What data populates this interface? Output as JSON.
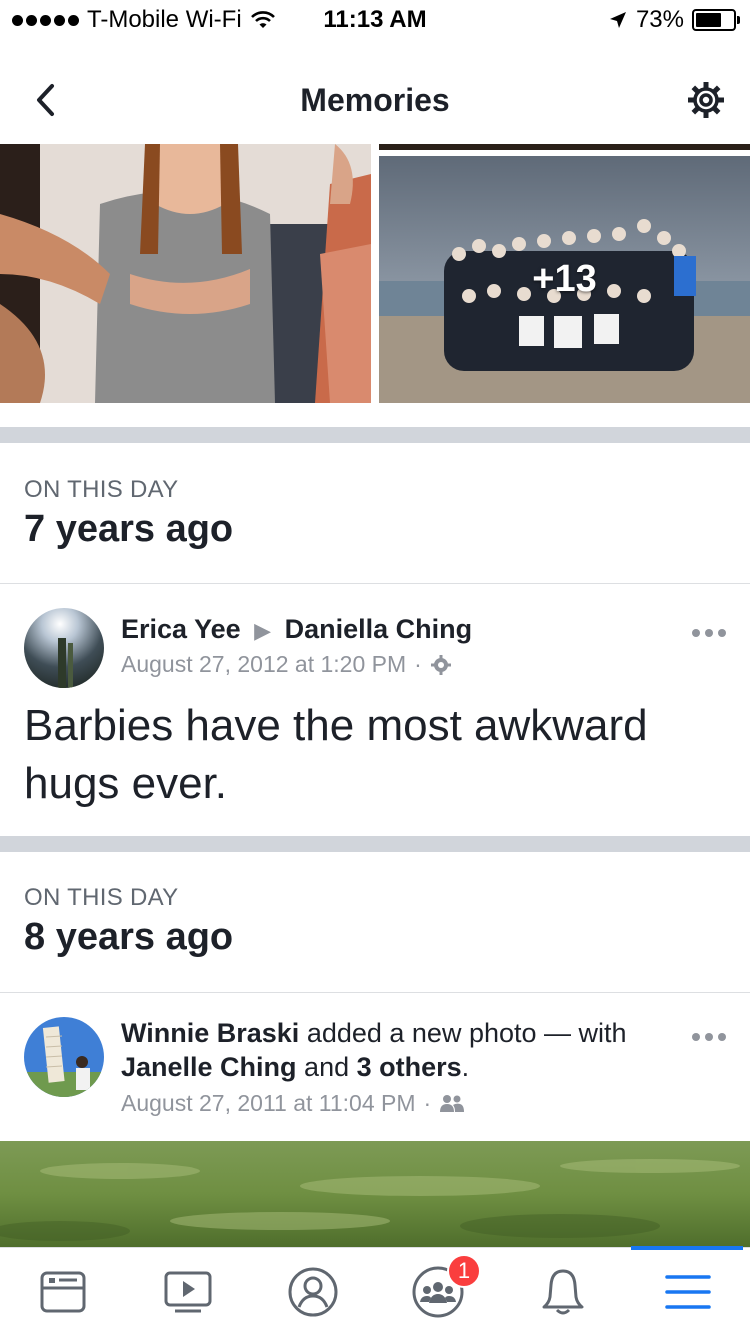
{
  "status_bar": {
    "carrier": "T-Mobile Wi-Fi",
    "time": "11:13 AM",
    "battery": "73%"
  },
  "nav": {
    "title": "Memories"
  },
  "photos": {
    "more_count": "+13"
  },
  "memories": [
    {
      "day_label": "ON THIS DAY",
      "years_ago": "7 years ago",
      "post": {
        "author": "Erica Yee",
        "target": "Daniella Ching",
        "timestamp": "August 27, 2012 at 1:20 PM",
        "text": "Barbies have the most awkward hugs ever."
      }
    },
    {
      "day_label": "ON THIS DAY",
      "years_ago": "8 years ago",
      "post": {
        "author": "Winnie Braski",
        "action": " added a new photo — with",
        "tagged": "Janelle Ching",
        "and": " and ",
        "others": "3 others",
        "period": ".",
        "timestamp": "August 27, 2011 at 11:04 PM"
      }
    }
  ],
  "tab_bar": {
    "notification_badge": "1"
  },
  "colors": {
    "accent": "#1877f2",
    "badge": "#fa3e3e",
    "divider": "#d1d5db"
  }
}
